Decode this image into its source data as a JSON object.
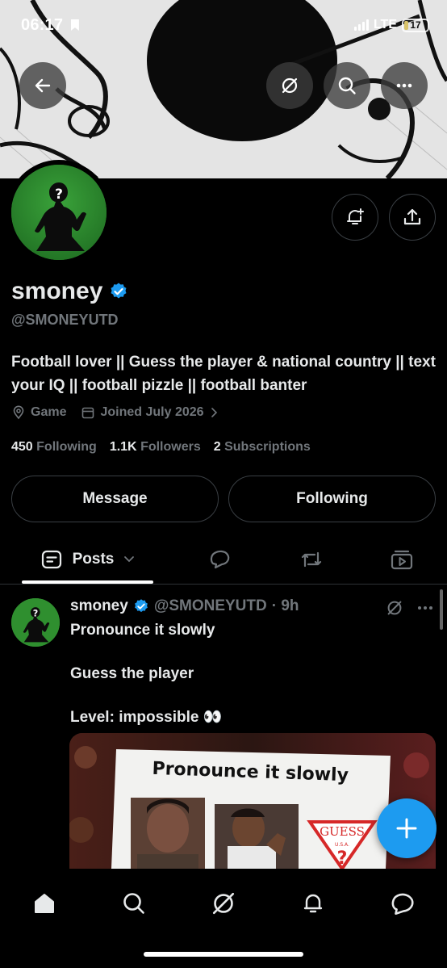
{
  "status_bar": {
    "time": "06:17",
    "network": "LTE",
    "battery": "17",
    "battery_level": 0.17,
    "battery_color": "#d9c36a"
  },
  "header_actions": {
    "back_icon": "arrow-left-icon",
    "grok_icon": "grok-icon",
    "search_icon": "search-icon",
    "more_icon": "more-horizontal-icon"
  },
  "profile": {
    "display_name": "smoney",
    "handle": "@SMONEYUTD",
    "verified": true,
    "bio": "Football lover || Guess the player & national country || text your IQ || football pizzle || football banter",
    "category": "Game",
    "joined": "Joined July 2026",
    "following_count": "450",
    "following_label": "Following",
    "followers_count": "1.1K",
    "followers_label": "Followers",
    "subscriptions_count": "2",
    "subscriptions_label": "Subscriptions",
    "avatar_glyph": "?"
  },
  "actions": {
    "message_label": "Message",
    "following_label": "Following"
  },
  "tabs": {
    "posts_label": "Posts",
    "items": [
      "posts",
      "replies",
      "reposts",
      "videos"
    ]
  },
  "post": {
    "author_name": "smoney",
    "author_handle": "@SMONEYUTD",
    "time": "· 9h",
    "line1": "Pronounce it slowly",
    "line2": "Guess the player",
    "line3": "Level: impossible 👀",
    "media_caption": "Pronounce it slowly",
    "media_brand": "GUESS",
    "media_brand_sub": "U.S.A.",
    "media_question": "?"
  },
  "bottom_nav": {
    "items": [
      "home",
      "search",
      "grok",
      "notifications",
      "messages"
    ]
  },
  "colors": {
    "accent": "#1d9bf0",
    "background": "#000000",
    "text_primary": "#e7e9ea",
    "text_secondary": "#71767b",
    "border": "#3a3f44"
  }
}
